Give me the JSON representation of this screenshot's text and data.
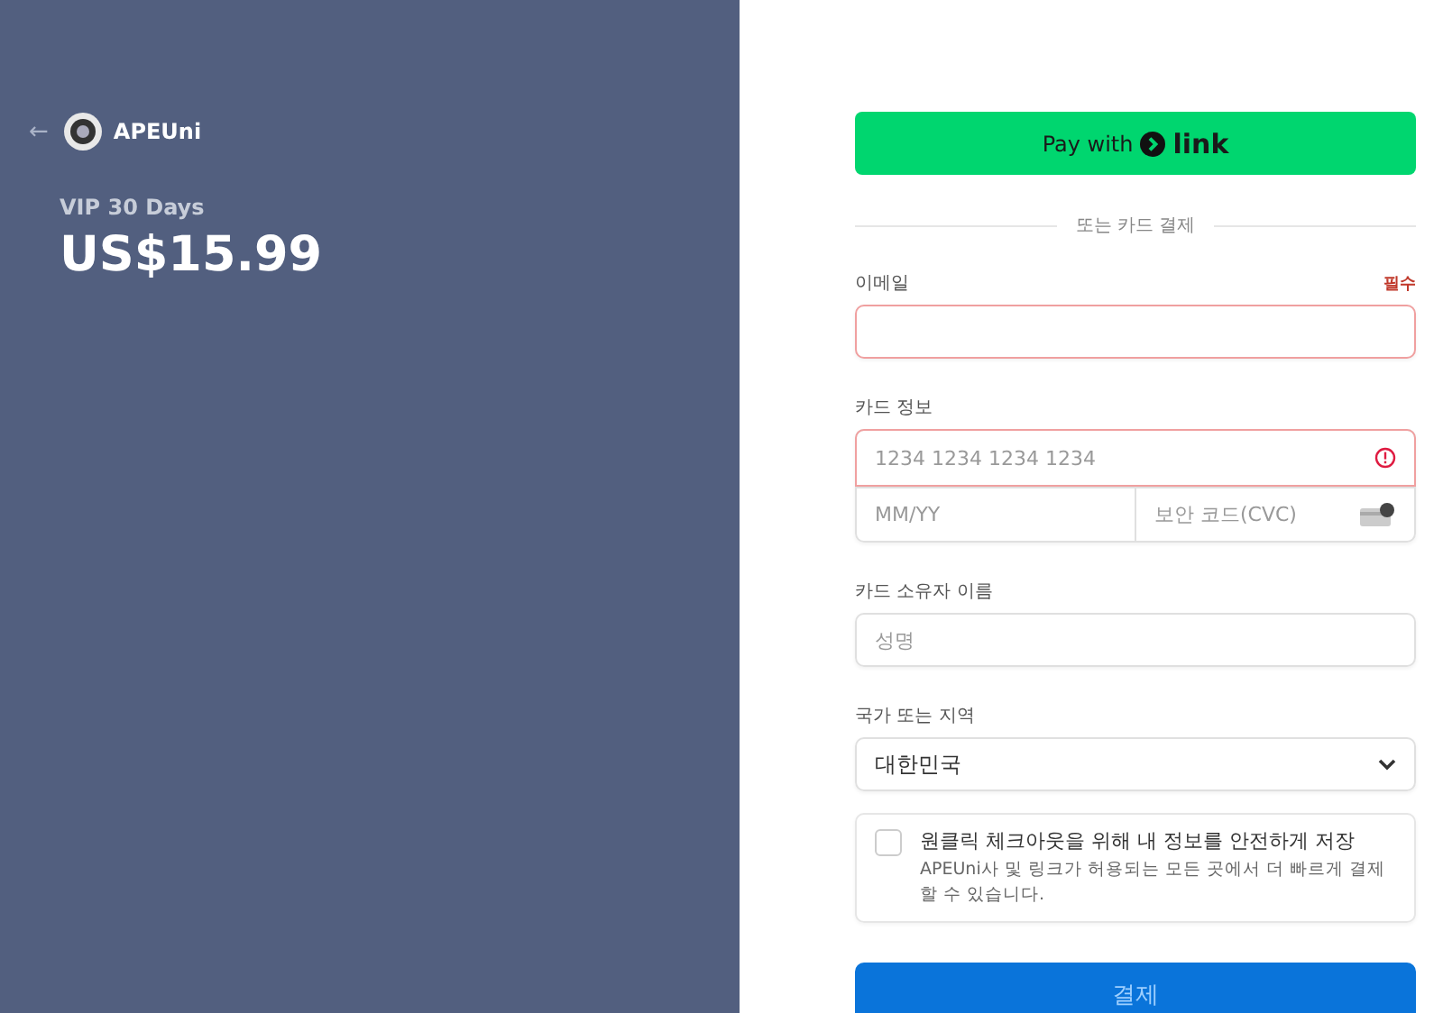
{
  "merchant": {
    "back": "←",
    "name": "APEUni"
  },
  "product": {
    "name": "VIP 30 Days",
    "price": "US$15.99"
  },
  "link_button": {
    "prefix": "Pay with",
    "brand": "link"
  },
  "divider": "또는 카드 결제",
  "email": {
    "label": "이메일",
    "required": "필수",
    "error": true
  },
  "card": {
    "label": "카드 정보",
    "number_placeholder": "1234 1234 1234 1234",
    "number_error": true,
    "expiry_placeholder": "MM/YY",
    "cvc_placeholder": "보안 코드(CVC)"
  },
  "cardholder": {
    "label": "카드 소유자 이름",
    "placeholder": "성명"
  },
  "country": {
    "label": "국가 또는 지역",
    "value": "대한민국"
  },
  "save_info": {
    "checked": false,
    "title": "원클릭 체크아웃을 위해 내 정보를 안전하게 저장",
    "description": "APEUni사 및 링크가 허용되는 모든 곳에서 더 빠르게 결제할 수 있습니다."
  },
  "submit": "결제"
}
